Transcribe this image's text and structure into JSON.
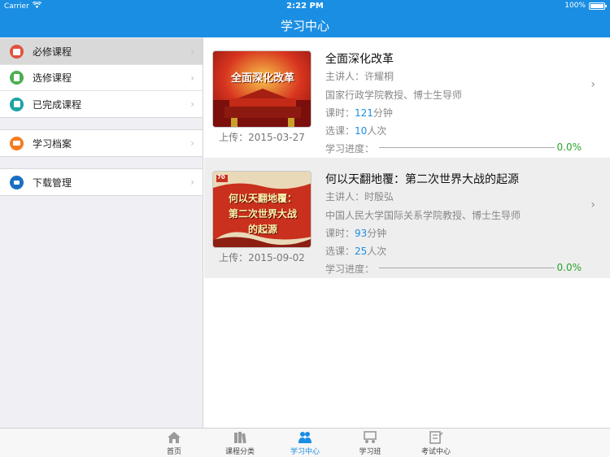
{
  "status_bar": {
    "carrier": "Carrier",
    "time": "2:22 PM",
    "battery": "100%"
  },
  "header": {
    "title": "学习中心"
  },
  "sidebar": {
    "groups": [
      {
        "items": [
          {
            "label": "必修课程",
            "icon": "book-icon",
            "color": "#e0533d",
            "active": true
          },
          {
            "label": "选修课程",
            "icon": "document-icon",
            "color": "#4caf50",
            "active": false
          },
          {
            "label": "已完成课程",
            "icon": "checklist-icon",
            "color": "#1aa3a3",
            "active": false
          }
        ]
      },
      {
        "items": [
          {
            "label": "学习档案",
            "icon": "archive-icon",
            "color": "#f57c1f",
            "active": false
          }
        ]
      },
      {
        "items": [
          {
            "label": "下载管理",
            "icon": "download-icon",
            "color": "#1a6fc2",
            "active": false
          }
        ]
      }
    ]
  },
  "courses": [
    {
      "title": "全面深化改革",
      "lecturer_label": "主讲人：",
      "lecturer": "许耀桐",
      "affiliation": "国家行政学院教授、博士生导师",
      "hours_label": "课时：",
      "hours": "121",
      "hours_unit": "分钟",
      "enroll_label": "选课：",
      "enroll": "10",
      "enroll_unit": "人次",
      "progress_label": "学习进度：",
      "progress": 0.0,
      "progress_text": "0.0%",
      "upload": "上传：2015-03-27",
      "thumb_text": "全面深化改革"
    },
    {
      "title": "何以天翻地覆：第二次世界大战的起源",
      "lecturer_label": "主讲人：",
      "lecturer": "时殷弘",
      "affiliation": "中国人民大学国际关系学院教授、博士生导师",
      "hours_label": "课时：",
      "hours": "93",
      "hours_unit": "分钟",
      "enroll_label": "选课：",
      "enroll": "25",
      "enroll_unit": "人次",
      "progress_label": "学习进度：",
      "progress": 0.0,
      "progress_text": "0.0%",
      "upload": "上传：2015-09-02",
      "thumb_lines": [
        "何以天翻地覆：",
        "第二次世界大战",
        "的起源"
      ],
      "thumb_badge": "70"
    }
  ],
  "tabs": [
    {
      "label": "首页",
      "icon": "home-icon",
      "active": false
    },
    {
      "label": "课程分类",
      "icon": "books-icon",
      "active": false
    },
    {
      "label": "学习中心",
      "icon": "people-icon",
      "active": true
    },
    {
      "label": "学习班",
      "icon": "classroom-icon",
      "active": false
    },
    {
      "label": "考试中心",
      "icon": "exam-icon",
      "active": false
    }
  ],
  "colors": {
    "accent": "#1a8ee3",
    "progress": "#29a329",
    "sidebar_bg": "#efeff4"
  }
}
